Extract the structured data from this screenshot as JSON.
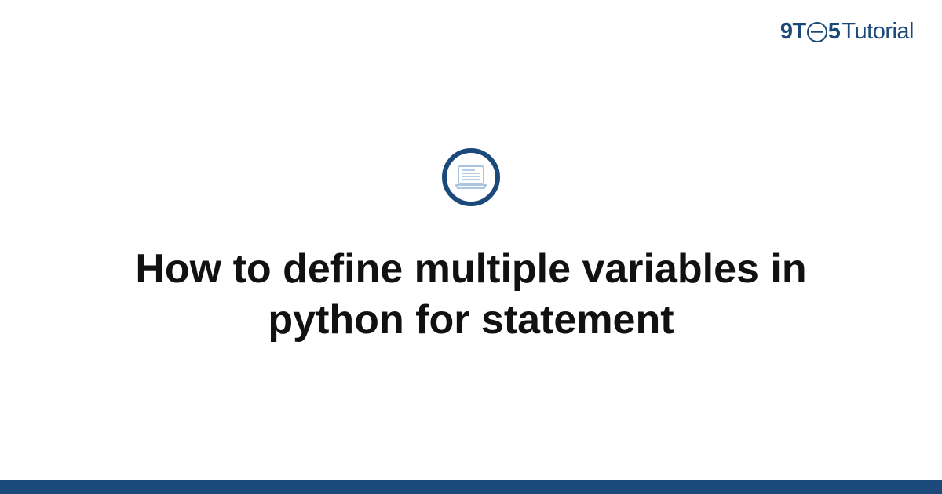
{
  "logo": {
    "nine": "9",
    "t_letter": "T",
    "five": "5",
    "tutorial": "Tutorial"
  },
  "icon": {
    "name": "laptop-icon"
  },
  "title": "How to define multiple variables in python for statement",
  "colors": {
    "brand": "#1b4a7a",
    "accent_light": "#a9c5e0",
    "text": "#111111"
  }
}
